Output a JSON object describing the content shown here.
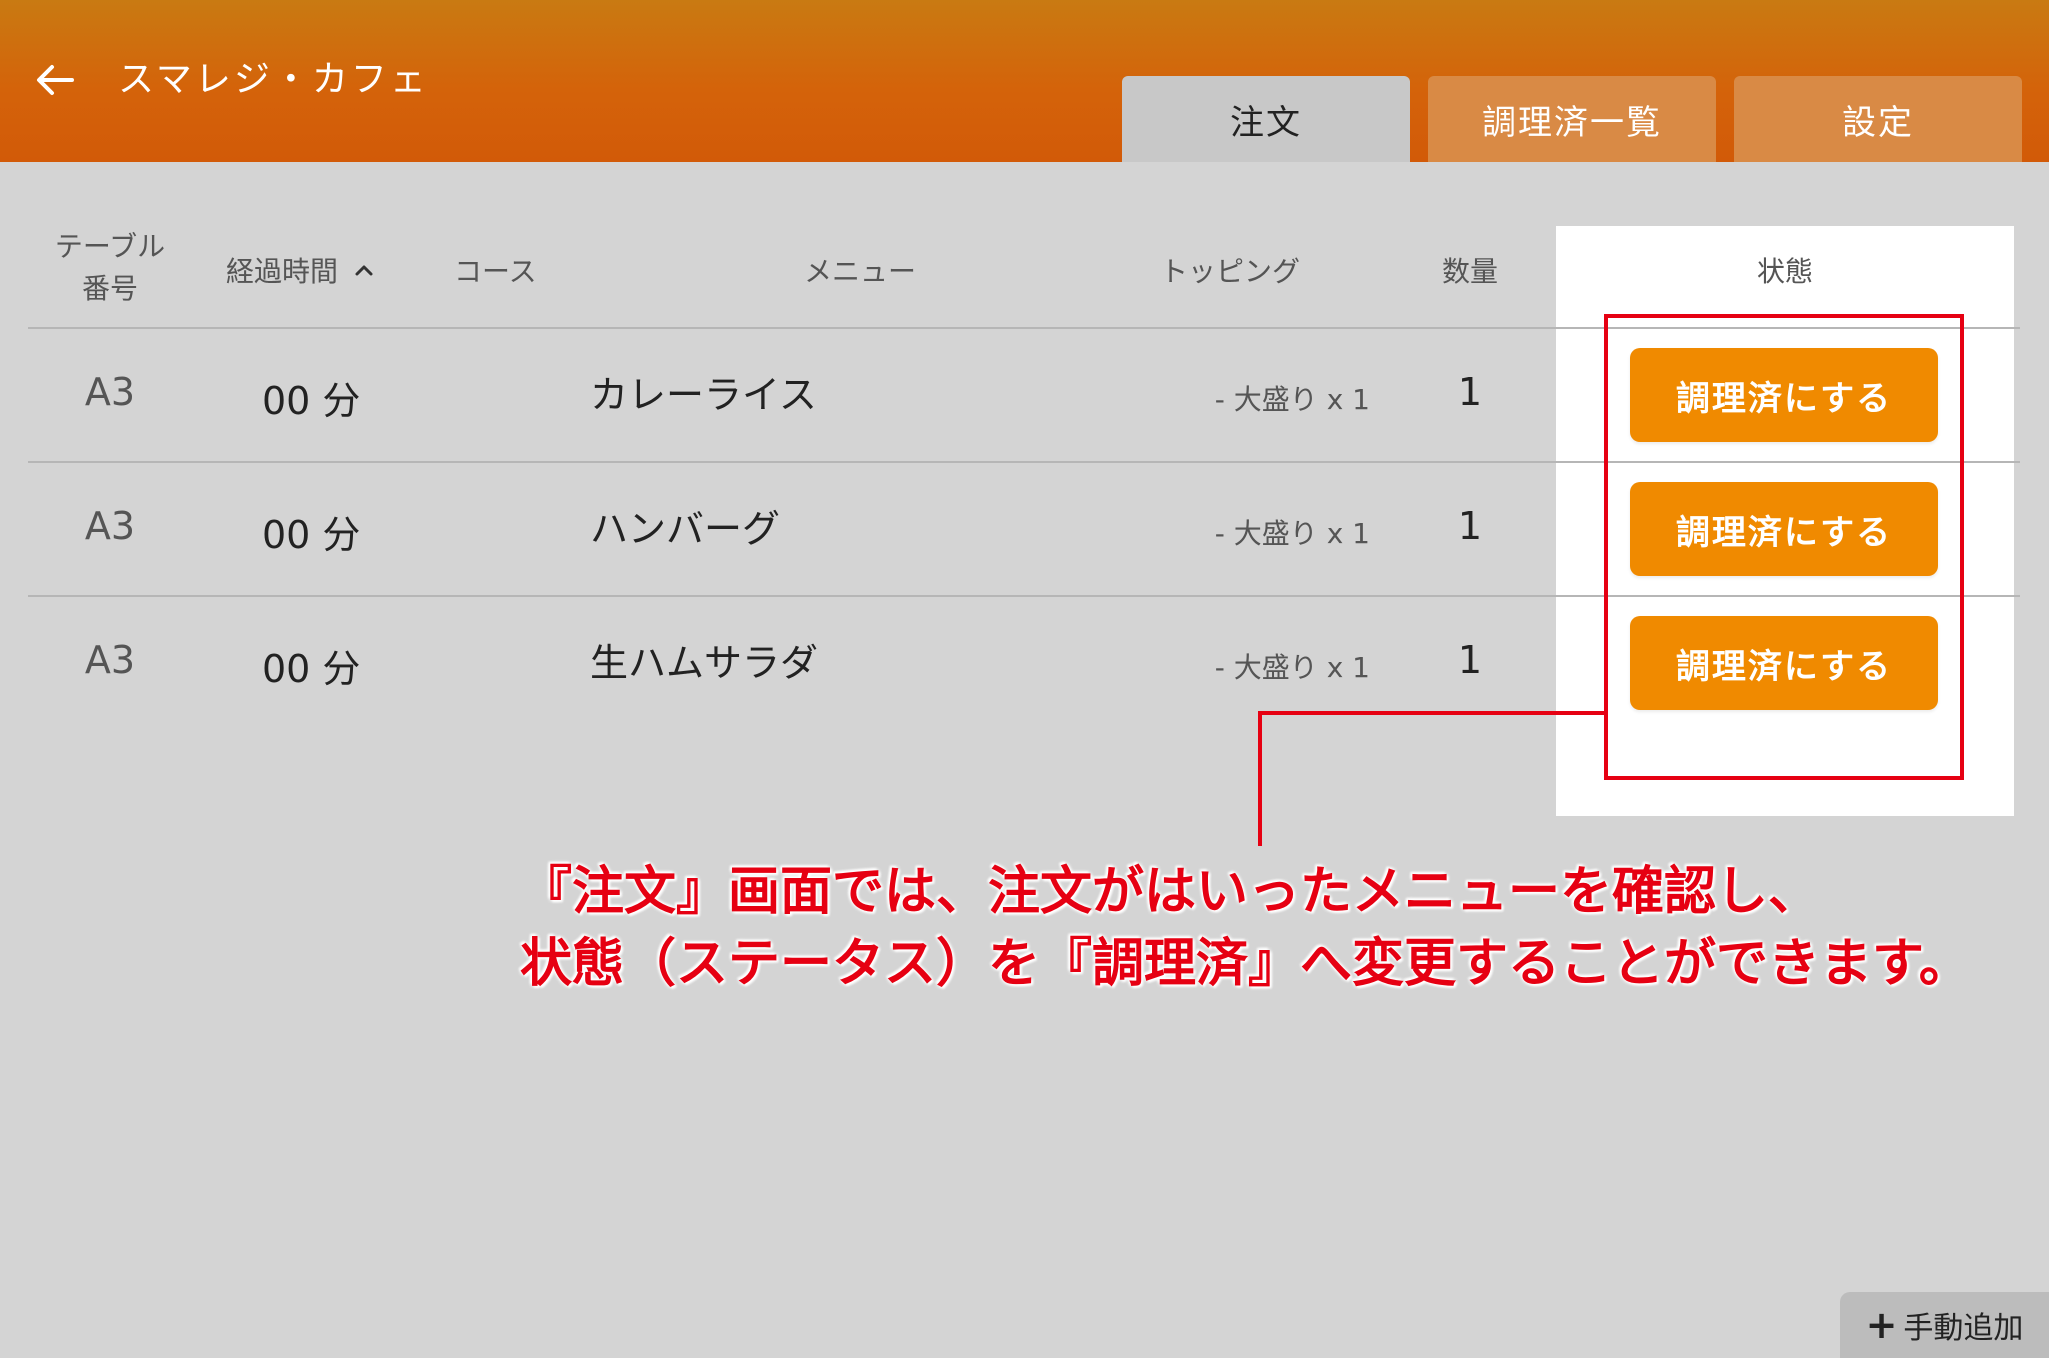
{
  "header": {
    "title": "スマレジ・カフェ",
    "tabs": [
      {
        "label": "注文",
        "active": true
      },
      {
        "label": "調理済一覧",
        "active": false
      },
      {
        "label": "設定",
        "active": false
      }
    ]
  },
  "columns": {
    "table_line1": "テーブル",
    "table_line2": "番号",
    "elapsed": "経過時間",
    "course": "コース",
    "menu": "メニュー",
    "topping": "トッピング",
    "quantity": "数量",
    "status": "状態"
  },
  "rows": [
    {
      "table": "A3",
      "elapsed": "00 分",
      "course": "",
      "menu": "カレーライス",
      "topping": "- 大盛り x 1",
      "quantity": "1",
      "action": "調理済にする"
    },
    {
      "table": "A3",
      "elapsed": "00 分",
      "course": "",
      "menu": "ハンバーグ",
      "topping": "- 大盛り x 1",
      "quantity": "1",
      "action": "調理済にする"
    },
    {
      "table": "A3",
      "elapsed": "00 分",
      "course": "",
      "menu": "生ハムサラダ",
      "topping": "- 大盛り x 1",
      "quantity": "1",
      "action": "調理済にする"
    }
  ],
  "annotation": {
    "line1": "『注文』画面では、注文がはいったメニューを確認し、",
    "line2": "状態（ステータス）を『調理済』へ変更することができます。"
  },
  "manual_add": {
    "label": "手動追加"
  },
  "colors": {
    "header_orange": "#d4630a",
    "button_orange": "#f08a00",
    "annotation_red": "#e60012",
    "background": "#d4d4d4"
  },
  "icons": [
    "arrow-left-icon",
    "chevron-up-icon",
    "plus-icon"
  ]
}
